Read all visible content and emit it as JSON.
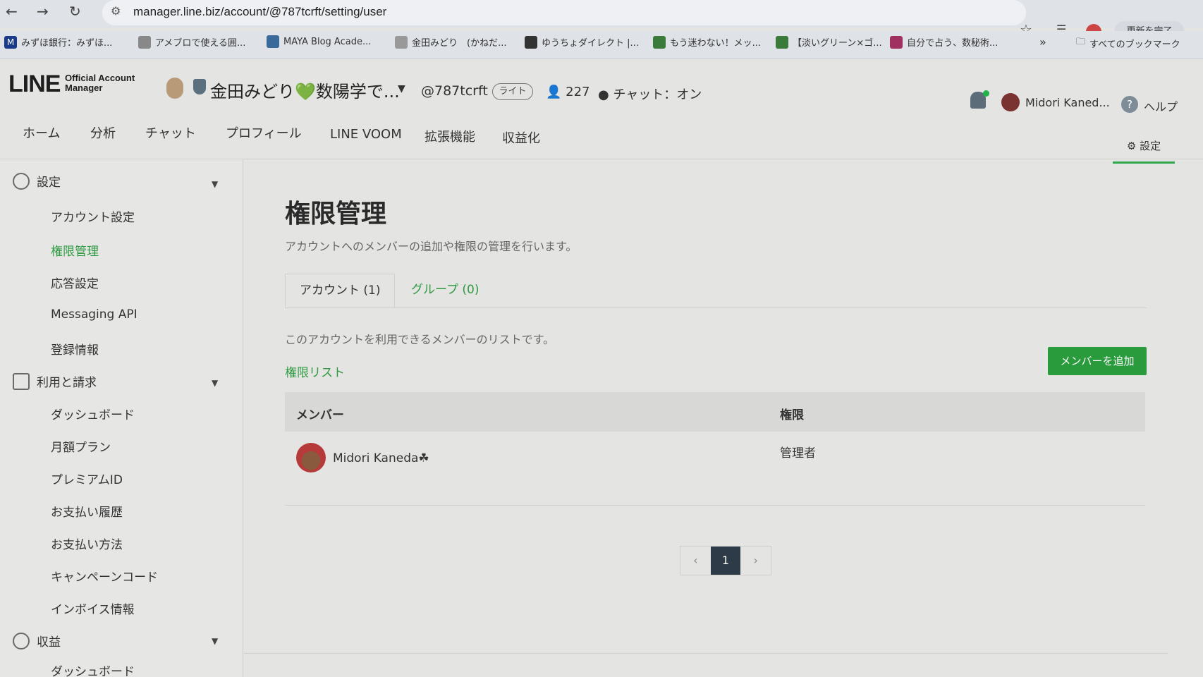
{
  "browser": {
    "url": "manager.line.biz/account/@787tcrft/setting/user",
    "update_button": "更新を完了",
    "bookmarks": [
      {
        "label": "みずほ銀行：みずほ...",
        "color": "#1a3a8a"
      },
      {
        "label": "アメブロで使える囲...",
        "color": "#888888"
      },
      {
        "label": "MAYA Blog Acade...",
        "color": "#3a6a9a"
      },
      {
        "label": "金田みどり　(かねだ...",
        "color": "#999999"
      },
      {
        "label": "ゆうちょダイレクト |...",
        "color": "#333333"
      },
      {
        "label": "もう迷わない！メッ...",
        "color": "#3a7a3a"
      },
      {
        "label": "【淡いグリーン×ゴ...",
        "color": "#3a7a3a"
      },
      {
        "label": "自分で占う、数秘術...",
        "color": "#a03060"
      }
    ],
    "all_bookmarks": "すべてのブックマーク"
  },
  "header": {
    "logo": "LINE",
    "logo_sub_1": "Official Account",
    "logo_sub_2": "Manager",
    "account_name": "金田みどり💚数陽学で...",
    "account_id": "@787tcrft",
    "plan": "ライト",
    "friends_count": "227",
    "chat_status": "チャット：オン",
    "user_name": "Midori Kaned...",
    "help": "ヘルプ"
  },
  "nav": {
    "items": [
      "ホーム",
      "分析",
      "チャット",
      "プロフィール",
      "LINE VOOM",
      "拡張機能",
      "収益化"
    ],
    "settings": "設定"
  },
  "sidebar": {
    "section_settings": "設定",
    "settings_items": [
      "アカウント設定",
      "権限管理",
      "応答設定",
      "Messaging API",
      "登録情報"
    ],
    "section_billing": "利用と請求",
    "billing_items": [
      "ダッシュボード",
      "月額プラン",
      "プレミアムID",
      "お支払い履歴",
      "お支払い方法",
      "キャンペーンコード",
      "インボイス情報"
    ],
    "section_revenue": "収益",
    "revenue_items": [
      "ダッシュボード"
    ]
  },
  "main": {
    "title": "権限管理",
    "description": "アカウントへのメンバーの追加や権限の管理を行います。",
    "tab_account": "アカウント (1)",
    "tab_group": "グループ (0)",
    "list_description": "このアカウントを利用できるメンバーのリストです。",
    "list_link": "権限リスト",
    "add_member": "メンバーを追加",
    "col_member": "メンバー",
    "col_role": "権限",
    "rows": [
      {
        "name": "Midori Kaneda☘",
        "role": "管理者"
      }
    ],
    "pager": {
      "prev": "‹",
      "current": "1",
      "next": "›"
    }
  },
  "colors": {
    "accent": "#2f9a42",
    "button": "#2a9b3c",
    "pager_current": "#2d3a47"
  }
}
